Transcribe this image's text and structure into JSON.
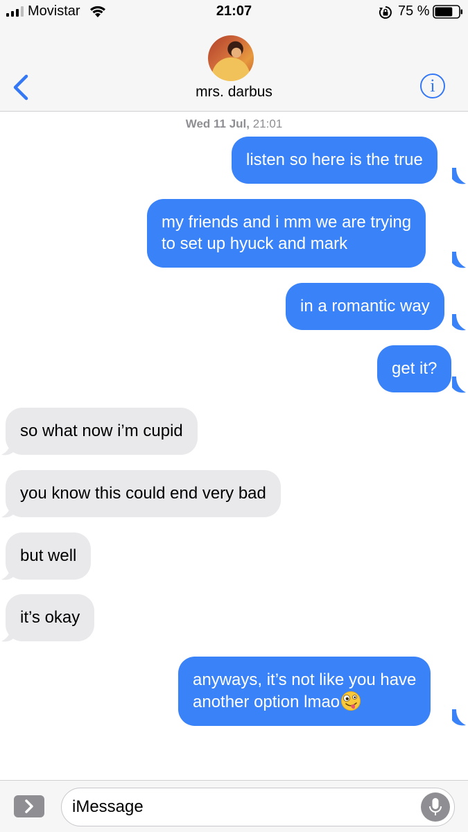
{
  "status_bar": {
    "carrier": "Movistar",
    "time": "21:07",
    "battery_percent": "75 %",
    "battery_level": 0.75
  },
  "header": {
    "contact_name": "mrs. darbus",
    "info_label": "i"
  },
  "conversation": {
    "timestamp_day": "Wed 11 Jul,",
    "timestamp_time": "21:01",
    "messages": [
      {
        "direction": "sent",
        "lines": [
          "listen so here is the true"
        ]
      },
      {
        "direction": "sent",
        "lines": [
          "my friends and i mm we are trying",
          "to set up hyuck and mark"
        ]
      },
      {
        "direction": "sent",
        "lines": [
          "in a romantic way"
        ]
      },
      {
        "direction": "sent",
        "lines": [
          "get it?"
        ]
      },
      {
        "direction": "received",
        "lines": [
          "so what now i’m cupid"
        ]
      },
      {
        "direction": "received",
        "lines": [
          "you know this could end very bad"
        ]
      },
      {
        "direction": "received",
        "lines": [
          "but well"
        ]
      },
      {
        "direction": "received",
        "lines": [
          "it’s okay"
        ]
      },
      {
        "direction": "sent",
        "lines": [
          "anyways, it’s not like you have",
          "another option lmao"
        ],
        "emoji": "zany-face"
      }
    ]
  },
  "input": {
    "placeholder": "iMessage"
  },
  "colors": {
    "sent_bubble": "#3a82f7",
    "received_bubble": "#e9e9eb",
    "accent": "#3478f6"
  }
}
